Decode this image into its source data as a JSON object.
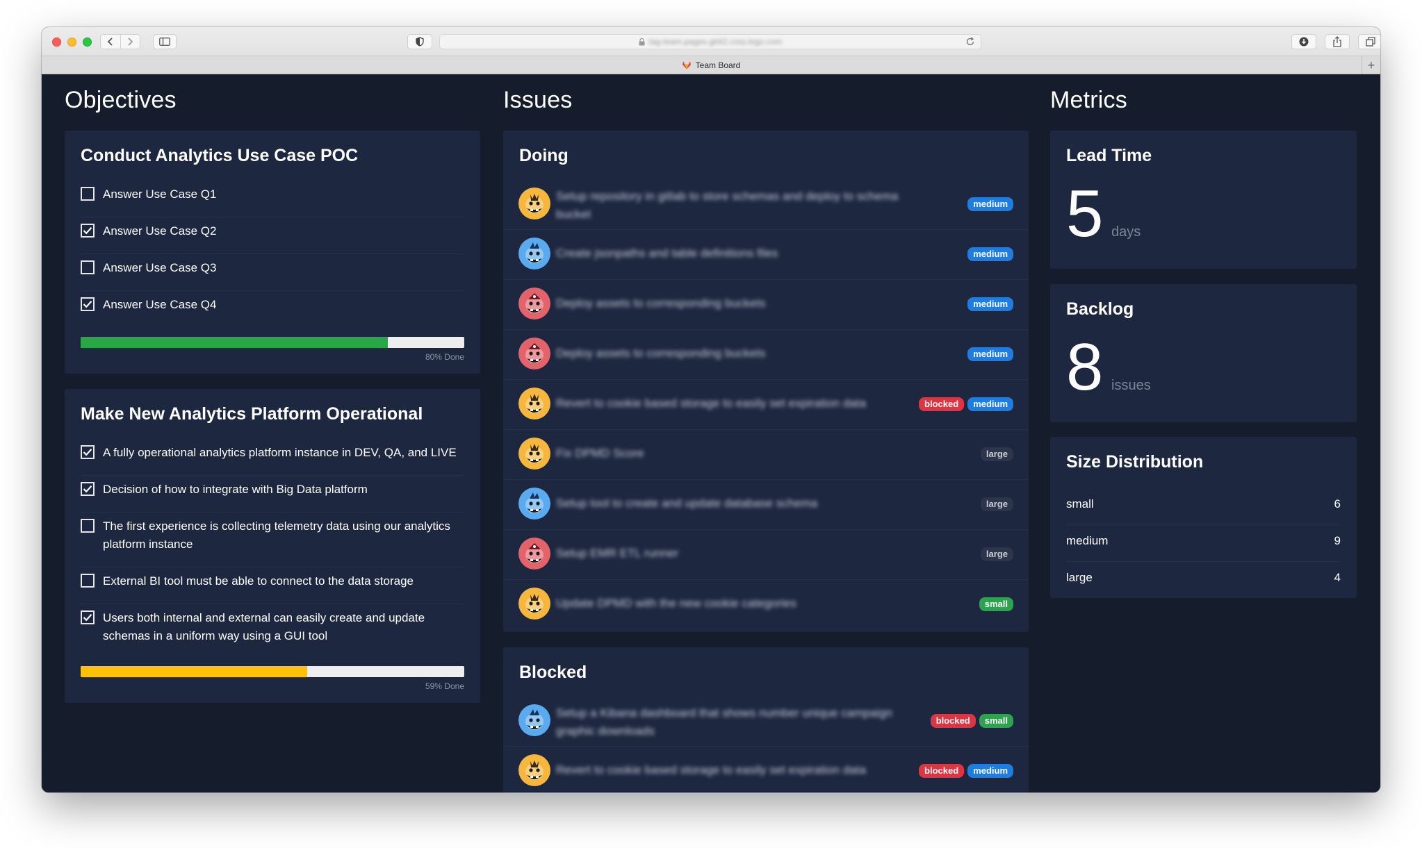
{
  "browser": {
    "url": "tag-team.pages.git42.corp.lego.com",
    "tab_title": "Team Board",
    "new_tab_label": "+"
  },
  "columns": {
    "objectives": "Objectives",
    "issues": "Issues",
    "metrics": "Metrics"
  },
  "objectives": [
    {
      "title": "Conduct Analytics Use Case POC",
      "items": [
        {
          "label": "Answer Use Case Q1",
          "checked": false
        },
        {
          "label": "Answer Use Case Q2",
          "checked": true
        },
        {
          "label": "Answer Use Case Q3",
          "checked": false
        },
        {
          "label": "Answer Use Case Q4",
          "checked": true
        }
      ],
      "progress": 0.8,
      "progress_label": "80% Done",
      "progress_color": "#28a745"
    },
    {
      "title": "Make New Analytics Platform Operational",
      "items": [
        {
          "label": "A fully operational analytics platform instance in DEV, QA, and LIVE",
          "checked": true
        },
        {
          "label": "Decision of how to integrate with Big Data platform",
          "checked": true
        },
        {
          "label": "The first experience is collecting telemetry data using our analytics platform instance",
          "checked": false
        },
        {
          "label": "External BI tool must be able to connect to the data storage",
          "checked": false
        },
        {
          "label": "Users both internal and external can easily create and update schemas in a uniform way using a GUI tool",
          "checked": true
        }
      ],
      "progress": 0.59,
      "progress_label": "59% Done",
      "progress_color": "#ffc107"
    }
  ],
  "issues": {
    "doing": {
      "title": "Doing",
      "rows": [
        {
          "avatar": "yellow",
          "title": "Setup repository in gitlab to store schemas and deploy to schema bucket",
          "badges": [
            "medium"
          ]
        },
        {
          "avatar": "blue",
          "title": "Create jsonpaths and table definitions files",
          "badges": [
            "medium"
          ]
        },
        {
          "avatar": "red",
          "title": "Deploy assets to corresponding buckets",
          "badges": [
            "medium"
          ]
        },
        {
          "avatar": "red",
          "title": "Deploy assets to corresponding buckets",
          "badges": [
            "medium"
          ]
        },
        {
          "avatar": "yellow",
          "title": "Revert to cookie based storage to easily set expiration data",
          "badges": [
            "blocked",
            "medium"
          ]
        },
        {
          "avatar": "yellow",
          "title": "Fix DPMD Score",
          "badges": [
            "large"
          ]
        },
        {
          "avatar": "blue",
          "title": "Setup tool to create and update database schema",
          "badges": [
            "large"
          ]
        },
        {
          "avatar": "red",
          "title": "Setup EMR ETL runner",
          "badges": [
            "large"
          ]
        },
        {
          "avatar": "yellow",
          "title": "Update DPMD with the new cookie categories",
          "badges": [
            "small"
          ]
        }
      ]
    },
    "blocked": {
      "title": "Blocked",
      "rows": [
        {
          "avatar": "blue",
          "title": "Setup a Kibana dashboard that shows number unique campaign graphic downloads",
          "badges": [
            "blocked",
            "small"
          ]
        },
        {
          "avatar": "yellow",
          "title": "Revert to cookie based storage to easily set expiration data",
          "badges": [
            "blocked",
            "medium"
          ]
        }
      ]
    }
  },
  "metrics": {
    "lead_time": {
      "title": "Lead Time",
      "value": "5",
      "unit": "days"
    },
    "backlog": {
      "title": "Backlog",
      "value": "8",
      "unit": "issues"
    },
    "size_distribution": {
      "title": "Size Distribution",
      "rows": [
        {
          "label": "small",
          "count": "6"
        },
        {
          "label": "medium",
          "count": "9"
        },
        {
          "label": "large",
          "count": "4"
        }
      ]
    }
  },
  "colors": {
    "background": "#151c2c",
    "card": "#1e2740",
    "badge_medium": "#1f7de0",
    "badge_blocked": "#db3642",
    "badge_large": "#2d354a",
    "badge_small": "#2ba44d",
    "avatar_yellow": "#f6b73c",
    "avatar_blue": "#5aaaf0",
    "avatar_red": "#e2636a"
  }
}
